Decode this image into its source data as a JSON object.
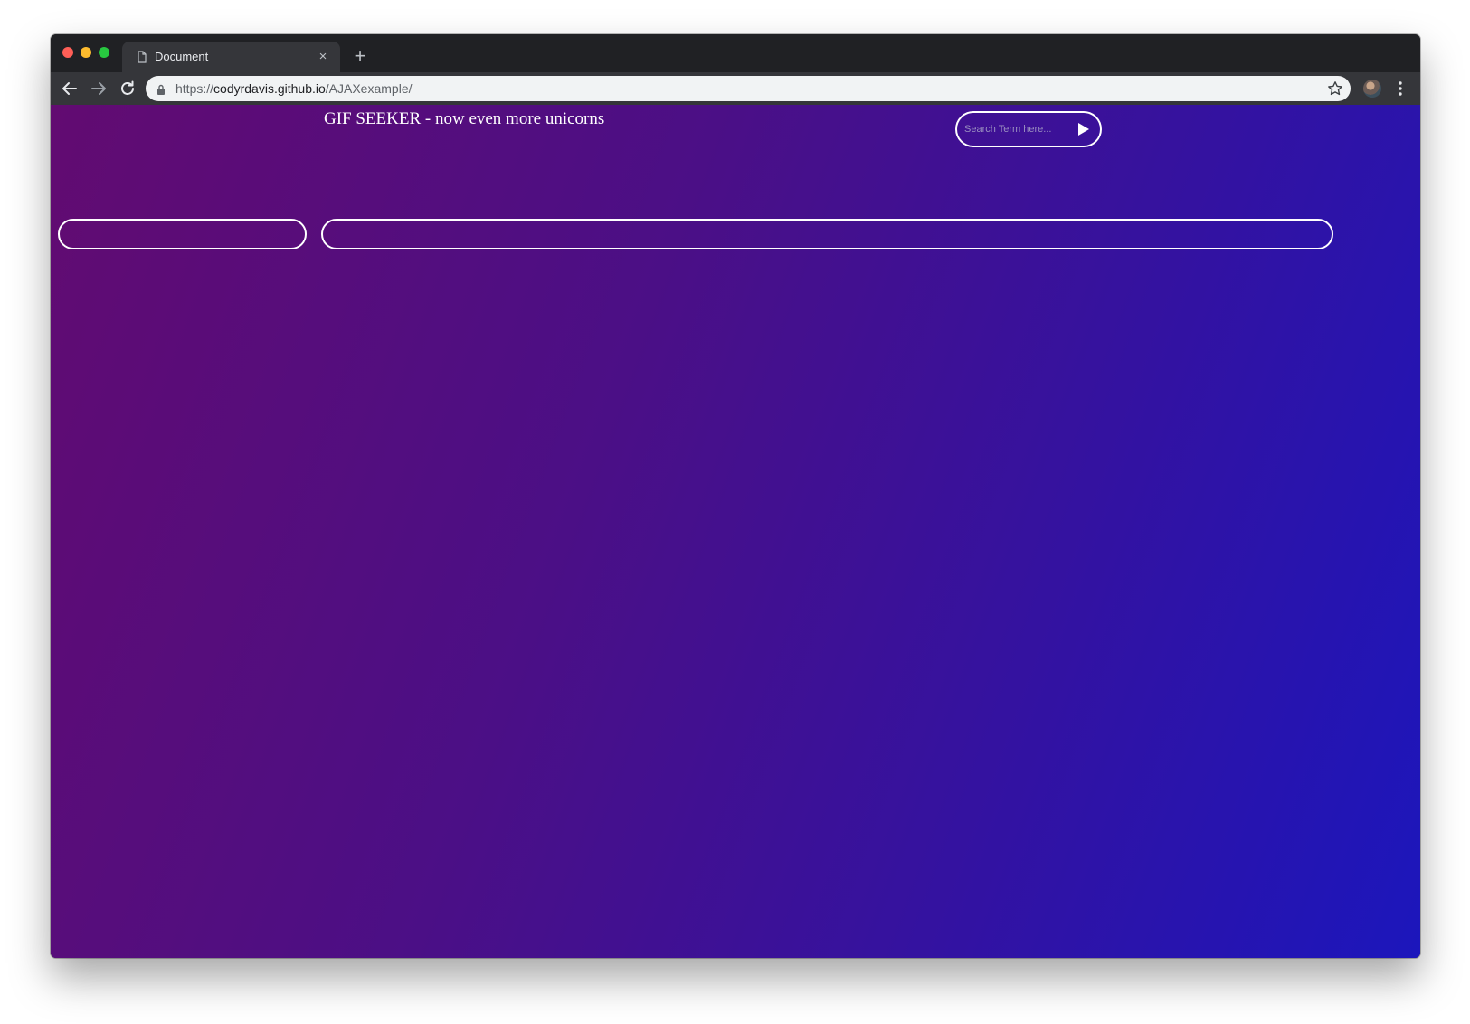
{
  "browser": {
    "tab": {
      "title": "Document",
      "favicon": "document-icon",
      "close": "×"
    },
    "new_tab": "+",
    "address": {
      "scheme": "https://",
      "host": "codyrdavis.github.io",
      "path": "/AJAXexample/"
    }
  },
  "page": {
    "title": "GIF SEEKER - now even more unicorns",
    "search": {
      "placeholder": "Search Term here...",
      "value": ""
    }
  },
  "colors": {
    "gradient_start": "#620b71",
    "gradient_end": "#1c16bc",
    "outline": "#ffffff",
    "chrome_dark": "#202124",
    "chrome_toolbar": "#35363a"
  },
  "icons": {
    "back": "arrow-left-icon",
    "forward": "arrow-right-icon",
    "reload": "reload-icon",
    "lock": "lock-icon",
    "bookmark": "star-icon",
    "menu": "kebab-menu-icon",
    "submit": "play-triangle-icon"
  }
}
